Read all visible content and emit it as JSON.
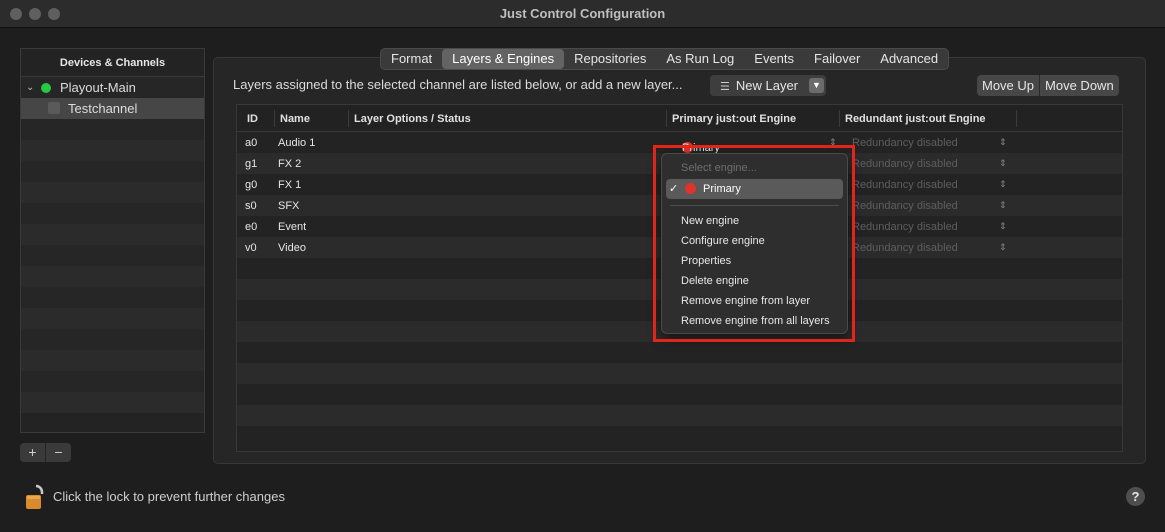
{
  "window": {
    "title": "Just Control Configuration"
  },
  "sidebar": {
    "header": "Devices & Channels",
    "items": [
      {
        "label": "Playout-Main",
        "expanded": true,
        "status_color": "#28c840"
      },
      {
        "label": "Testchannel",
        "selected": true
      }
    ],
    "add_label": "+",
    "remove_label": "−"
  },
  "tabs": [
    {
      "label": "Format"
    },
    {
      "label": "Layers & Engines",
      "active": true
    },
    {
      "label": "Repositories"
    },
    {
      "label": "As Run Log"
    },
    {
      "label": "Events"
    },
    {
      "label": "Failover"
    },
    {
      "label": "Advanced"
    }
  ],
  "toolbar": {
    "description": "Layers assigned to the selected channel are listed below, or add a new layer...",
    "new_layer_label": "New Layer",
    "move_up_label": "Move Up",
    "move_down_label": "Move Down"
  },
  "table": {
    "headers": {
      "id": "ID",
      "name": "Name",
      "options": "Layer Options / Status",
      "primary": "Primary just:out Engine",
      "redundant": "Redundant just:out Engine"
    },
    "rows": [
      {
        "id": "a0",
        "name": "Audio 1",
        "primary": "Primary",
        "redundant": "Redundancy disabled"
      },
      {
        "id": "g1",
        "name": "FX 2",
        "redundant": "Redundancy disabled"
      },
      {
        "id": "g0",
        "name": "FX 1",
        "redundant": "Redundancy disabled"
      },
      {
        "id": "s0",
        "name": "SFX",
        "redundant": "Redundancy disabled"
      },
      {
        "id": "e0",
        "name": "Event",
        "redundant": "Redundancy disabled"
      },
      {
        "id": "v0",
        "name": "Video",
        "redundant": "Redundancy disabled"
      }
    ]
  },
  "engine_menu": {
    "placeholder": "Select engine...",
    "selected": "Primary",
    "items": [
      "New engine",
      "Configure engine",
      "Properties",
      "Delete engine",
      "Remove engine from layer",
      "Remove engine from all layers"
    ]
  },
  "footer": {
    "lock_text": "Click the lock to prevent further changes",
    "help_label": "?"
  },
  "colors": {
    "engine_status": "#e0332b",
    "highlight_box": "#e1251b"
  }
}
